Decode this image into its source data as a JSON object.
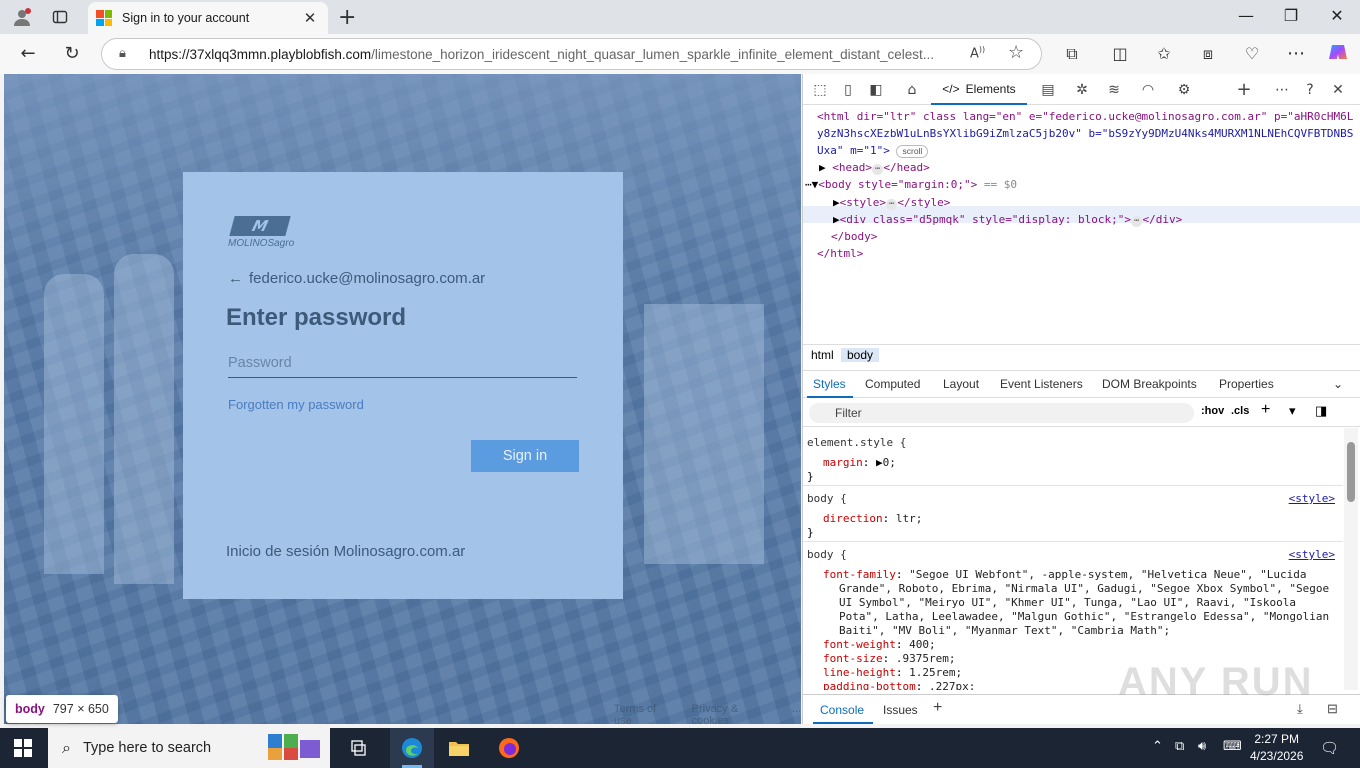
{
  "browser": {
    "tab_title": "Sign in to your account",
    "url_host": "https://37xlqq3mmn.playblobfish.com",
    "url_path": "/limestone_horizon_iridescent_night_quasar_lumen_sparkle_infinite_element_distant_celest..."
  },
  "page": {
    "logo_text": "MOLINOSagro",
    "identity": "federico.ucke@molinosagro.com.ar",
    "heading": "Enter password",
    "password_placeholder": "Password",
    "forgot_link": "Forgotten my password",
    "signin_button": "Sign in",
    "footer_text": "Inicio de sesión Molinosagro.com.ar",
    "footer_links": [
      "Terms of use",
      "Privacy & cookies",
      "..."
    ]
  },
  "inspect_tooltip": {
    "tag": "body",
    "dims": "797 × 650"
  },
  "devtools": {
    "elements_tab": "Elements",
    "dom": {
      "html_open_1": "<html dir=\"ltr\" class lang=\"en\" e=\"federico.ucke@molinosagro.com.ar\" p=\"aHR0cHM6L",
      "html_open_2": "y8zN3hscXEzbW1uLnBsYXlibG9iZmlzaC5jb20v\" b=\"bS9zYy9DMzU4Nks4MURXM1NLNEhCQVFBTDNBS",
      "html_open_3": "Uxa\" m=\"1\">",
      "scroll_badge": "scroll",
      "head_line": "<head>",
      "head_close": "</head>",
      "body_line": "<body style=\"margin:0;\">",
      "body_marker": "== $0",
      "style_line": "<style>",
      "style_close": "</style>",
      "div_line": "<div class=\"d5pmqk\" style=\"display: block;\">",
      "div_close": "</div>",
      "body_close": "</body>",
      "html_close": "</html>"
    },
    "breadcrumbs": [
      "html",
      "body"
    ],
    "sub_tabs": [
      "Styles",
      "Computed",
      "Layout",
      "Event Listeners",
      "DOM Breakpoints",
      "Properties"
    ],
    "filter_placeholder": "Filter",
    "filter_tools": [
      ":hov",
      ".cls"
    ],
    "styles": {
      "r1_selector": "element.style {",
      "r1_prop": "margin",
      "r1_val": "0;",
      "r2_selector": "body {",
      "r2_src": "<style>",
      "r2_prop": "direction",
      "r2_val": "ltr;",
      "r3_selector": "body {",
      "r3_src": "<style>",
      "r3_ff_prop": "font-family",
      "r3_ff_l1": "\"Segoe UI Webfont\", -apple-system, \"Helvetica Neue\", \"Lucida",
      "r3_ff_l2": "Grande\", Roboto, Ebrima, \"Nirmala UI\", Gadugi, \"Segoe Xbox Symbol\", \"Segoe",
      "r3_ff_l3": "UI Symbol\", \"Meiryo UI\", \"Khmer UI\", Tunga, \"Lao UI\", Raavi, \"Iskoola",
      "r3_ff_l4": "Pota\", Latha, Leelawadee, \"Malgun Gothic\", \"Estrangelo Edessa\", \"Mongolian",
      "r3_ff_l5": "Baiti\", \"MV Boli\", \"Myanmar Text\", \"Cambria Math\";",
      "r3_fw_prop": "font-weight",
      "r3_fw_val": "400;",
      "r3_fs_prop": "font-size",
      "r3_fs_val": ".9375rem;",
      "r3_lh_prop": "line-height",
      "r3_lh_val": "1.25rem;",
      "r3_pb_prop": "padding-bottom",
      "r3_pb_val": ".227px;"
    },
    "drawer_tabs": [
      "Console",
      "Issues"
    ]
  },
  "watermark": "ANY RUN",
  "taskbar": {
    "search_placeholder": "Type here to search",
    "time": "2:27 PM",
    "date": "4/23/2026"
  },
  "colors": {
    "tab_bar": "#dfe3e8",
    "card": "#a3c3e8",
    "signin_button": "#5b9be0",
    "taskbar": "#1c2534",
    "devtools_accent": "#0f6cbd"
  }
}
